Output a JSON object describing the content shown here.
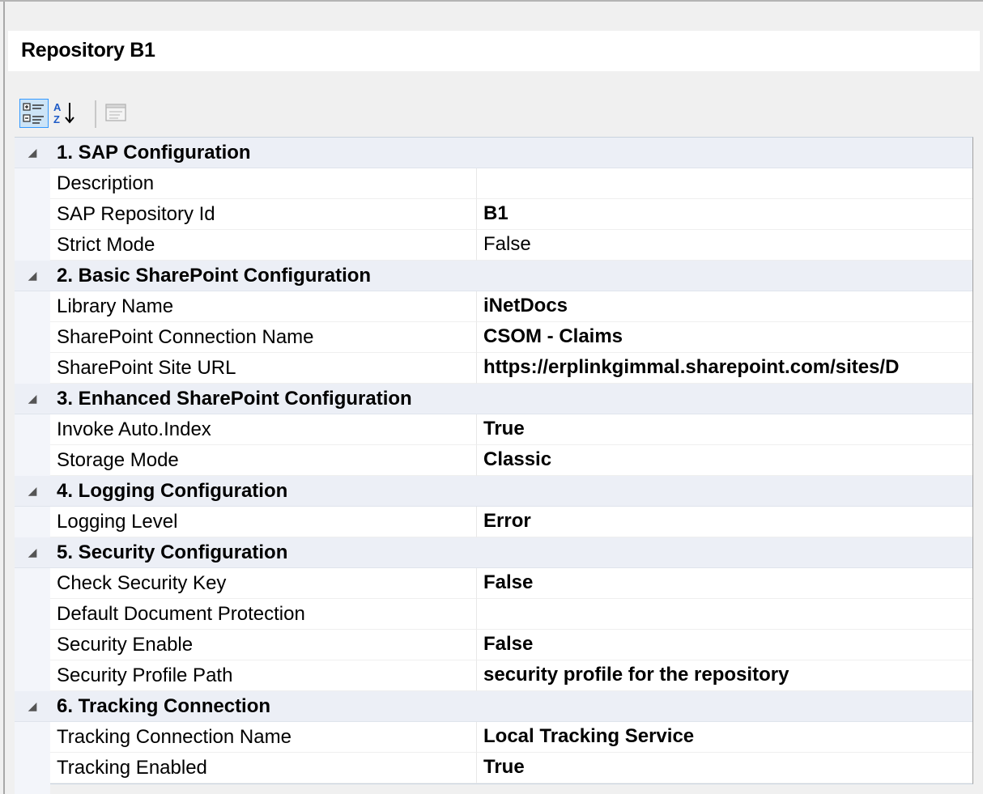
{
  "title": "Repository B1",
  "toolbar": {
    "categorized_icon": "categorized-list-icon",
    "alphabetical_icon": "sort-alphabetical-icon",
    "property_pages_icon": "property-pages-icon"
  },
  "categories": [
    {
      "label": "1. SAP Configuration",
      "properties": [
        {
          "name": "Description",
          "value": "",
          "bold": false
        },
        {
          "name": "SAP Repository Id",
          "value": "B1",
          "bold": true
        },
        {
          "name": "Strict Mode",
          "value": "False",
          "bold": false
        }
      ]
    },
    {
      "label": "2. Basic SharePoint Configuration",
      "properties": [
        {
          "name": "Library Name",
          "value": "iNetDocs",
          "bold": true
        },
        {
          "name": "SharePoint Connection Name",
          "value": "CSOM - Claims",
          "bold": true
        },
        {
          "name": "SharePoint Site URL",
          "value": "https://erplinkgimmal.sharepoint.com/sites/D",
          "bold": true
        }
      ]
    },
    {
      "label": "3. Enhanced SharePoint Configuration",
      "properties": [
        {
          "name": "Invoke Auto.Index",
          "value": "True",
          "bold": true
        },
        {
          "name": "Storage Mode",
          "value": "Classic",
          "bold": true
        }
      ]
    },
    {
      "label": "4. Logging Configuration",
      "properties": [
        {
          "name": "Logging Level",
          "value": "Error",
          "bold": true
        }
      ]
    },
    {
      "label": "5. Security Configuration",
      "properties": [
        {
          "name": "Check Security Key",
          "value": "False",
          "bold": true
        },
        {
          "name": "Default Document Protection",
          "value": "",
          "bold": false
        },
        {
          "name": "Security Enable",
          "value": "False",
          "bold": true
        },
        {
          "name": "Security Profile Path",
          "value": "security profile for the repository",
          "bold": true
        }
      ]
    },
    {
      "label": "6. Tracking Connection",
      "properties": [
        {
          "name": "Tracking Connection Name",
          "value": "Local Tracking Service",
          "bold": true
        },
        {
          "name": "Tracking Enabled",
          "value": "True",
          "bold": true
        }
      ]
    }
  ],
  "colors": {
    "category_bg": "#eceff6",
    "gutter_bg": "#f3f5fa",
    "selected_button_border": "#3399ff",
    "selected_button_bg": "#cce4f7"
  }
}
